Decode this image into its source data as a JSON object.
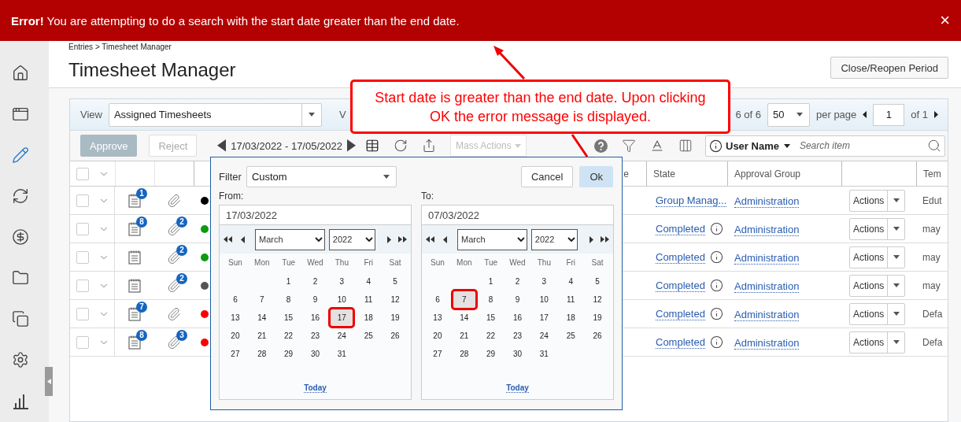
{
  "error_banner": {
    "message": "**Error!** You are attempting to do a search with the start date greater than the end date.",
    "close": "×"
  },
  "sidebar": {
    "items": [
      {
        "selected": false
      },
      {
        "selected": false
      },
      {
        "selected": true
      },
      {
        "selected": false
      },
      {
        "selected": false
      },
      {
        "selected": false
      },
      {
        "selected": false
      },
      {
        "selected": false
      },
      {
        "selected": false
      }
    ]
  },
  "breadcrumb": "Entries > Timesheet Manager",
  "title": "Timesheet Manager",
  "close_period_button": "Close/Reopen Period",
  "view_bar": {
    "label": "View",
    "value": "Assigned Timesheets",
    "label_2": "V",
    "count": "6 of 6",
    "page_size": "50",
    "per_page": "per page",
    "page": "1",
    "page_total": "of 1"
  },
  "toolbar": {
    "buttons": [
      {
        "label": "Approve",
        "kind": "primary",
        "disabled": true
      },
      {
        "label": "Reject",
        "kind": "secondary",
        "disabled": true
      }
    ],
    "date_range": "17/03/2022 - 17/05/2022",
    "mass_actions": {
      "label": "Mass Actions",
      "disabled": true
    },
    "search": {
      "field": "User Name",
      "placeholder": "Search item"
    }
  },
  "table": {
    "header_checkbox": {
      "checked": false
    },
    "columns": [
      "e",
      "State",
      "Approval Group",
      "Tem"
    ],
    "rows": [
      {
        "checked": false,
        "notes_badge": "1",
        "color": "#000000",
        "state": "Group Manag...",
        "state_info": false,
        "approval_group": "Administration",
        "actions": "Actions",
        "column_5": "Edut"
      },
      {
        "checked": false,
        "notes_badge": "8",
        "attachments_badge": "2",
        "color": "#0f9a0f",
        "state": "Completed",
        "state_info": true,
        "approval_group": "Administration",
        "actions": "Actions",
        "column_5": "may"
      },
      {
        "checked": false,
        "attachments_badge": "2",
        "color": "#0f9a0f",
        "state": "Completed",
        "state_info": true,
        "approval_group": "Administration",
        "actions": "Actions",
        "column_5": "may"
      },
      {
        "checked": false,
        "attachments_badge": "2",
        "color": "#555555",
        "state": "Completed",
        "state_info": true,
        "approval_group": "Administration",
        "actions": "Actions",
        "column_5": "may"
      },
      {
        "checked": false,
        "notes_badge": "7",
        "color": "#ff0000",
        "state": "Completed",
        "state_info": true,
        "approval_group": "Administration",
        "actions": "Actions",
        "column_5": "Defa"
      },
      {
        "checked": false,
        "notes_badge": "8",
        "attachments_badge": "3",
        "color": "#ff0000",
        "state": "Completed",
        "state_info": true,
        "approval_group": "Administration",
        "actions": "Actions",
        "column_5": "Defa"
      }
    ]
  },
  "date_filter": {
    "label": "Filter",
    "value": "Custom",
    "buttons": [
      {
        "label": "Cancel",
        "kind": "secondary"
      },
      {
        "label": "Ok",
        "kind": "primary"
      }
    ],
    "calendars": [
      {
        "label": "From:",
        "value": "17/03/2022",
        "month": "March",
        "year": "2022",
        "weekdays": [
          "Sun",
          "Mon",
          "Tue",
          "Wed",
          "Thu",
          "Fri",
          "Sat"
        ],
        "today": "Today",
        "weeks": [
          [
            {
              "day": "1",
              "selected": false
            },
            {
              "day": "2",
              "selected": false
            },
            {
              "day": "3",
              "selected": false
            },
            {
              "day": "4",
              "selected": false
            },
            {
              "day": "5",
              "selected": false
            }
          ],
          [
            {
              "day": "6",
              "selected": false
            },
            {
              "day": "7",
              "selected": false
            },
            {
              "day": "8",
              "selected": false
            },
            {
              "day": "9",
              "selected": false
            },
            {
              "day": "10",
              "selected": false
            },
            {
              "day": "11",
              "selected": false
            },
            {
              "day": "12",
              "selected": false
            }
          ],
          [
            {
              "day": "13",
              "selected": false
            },
            {
              "day": "14",
              "selected": false
            },
            {
              "day": "15",
              "selected": false
            },
            {
              "day": "16",
              "selected": false
            },
            {
              "day": "17",
              "selected": true
            },
            {
              "day": "18",
              "selected": false
            },
            {
              "day": "19",
              "selected": false
            }
          ],
          [
            {
              "day": "20",
              "selected": false
            },
            {
              "day": "21",
              "selected": false
            },
            {
              "day": "22",
              "selected": false
            },
            {
              "day": "23",
              "selected": false
            },
            {
              "day": "24",
              "selected": false
            },
            {
              "day": "25",
              "selected": false
            },
            {
              "day": "26",
              "selected": false
            }
          ],
          [
            {
              "day": "27",
              "selected": false
            },
            {
              "day": "28",
              "selected": false
            },
            {
              "day": "29",
              "selected": false
            },
            {
              "day": "30",
              "selected": false
            },
            {
              "day": "31",
              "selected": false
            }
          ]
        ]
      },
      {
        "label": "To:",
        "value": "07/03/2022",
        "month": "March",
        "year": "2022",
        "weekdays": [
          "Sun",
          "Mon",
          "Tue",
          "Wed",
          "Thu",
          "Fri",
          "Sat"
        ],
        "today": "Today",
        "weeks": [
          [
            {
              "day": "1",
              "selected": false
            },
            {
              "day": "2",
              "selected": false
            },
            {
              "day": "3",
              "selected": false
            },
            {
              "day": "4",
              "selected": false
            },
            {
              "day": "5",
              "selected": false
            }
          ],
          [
            {
              "day": "6",
              "selected": false
            },
            {
              "day": "7",
              "selected": true
            },
            {
              "day": "8",
              "selected": false
            },
            {
              "day": "9",
              "selected": false
            },
            {
              "day": "10",
              "selected": false
            },
            {
              "day": "11",
              "selected": false
            },
            {
              "day": "12",
              "selected": false
            }
          ],
          [
            {
              "day": "13",
              "selected": false
            },
            {
              "day": "14",
              "selected": false
            },
            {
              "day": "15",
              "selected": false
            },
            {
              "day": "16",
              "selected": false
            },
            {
              "day": "17",
              "selected": false
            },
            {
              "day": "18",
              "selected": false
            },
            {
              "day": "19",
              "selected": false
            }
          ],
          [
            {
              "day": "20",
              "selected": false
            },
            {
              "day": "21",
              "selected": false
            },
            {
              "day": "22",
              "selected": false
            },
            {
              "day": "23",
              "selected": false
            },
            {
              "day": "24",
              "selected": false
            },
            {
              "day": "25",
              "selected": false
            },
            {
              "day": "26",
              "selected": false
            }
          ],
          [
            {
              "day": "27",
              "selected": false
            },
            {
              "day": "28",
              "selected": false
            },
            {
              "day": "29",
              "selected": false
            },
            {
              "day": "30",
              "selected": false
            },
            {
              "day": "31",
              "selected": false
            }
          ]
        ]
      }
    ]
  },
  "annotation": {
    "text": "Start date is greater than the end date. Upon clicking OK the error message is displayed."
  }
}
